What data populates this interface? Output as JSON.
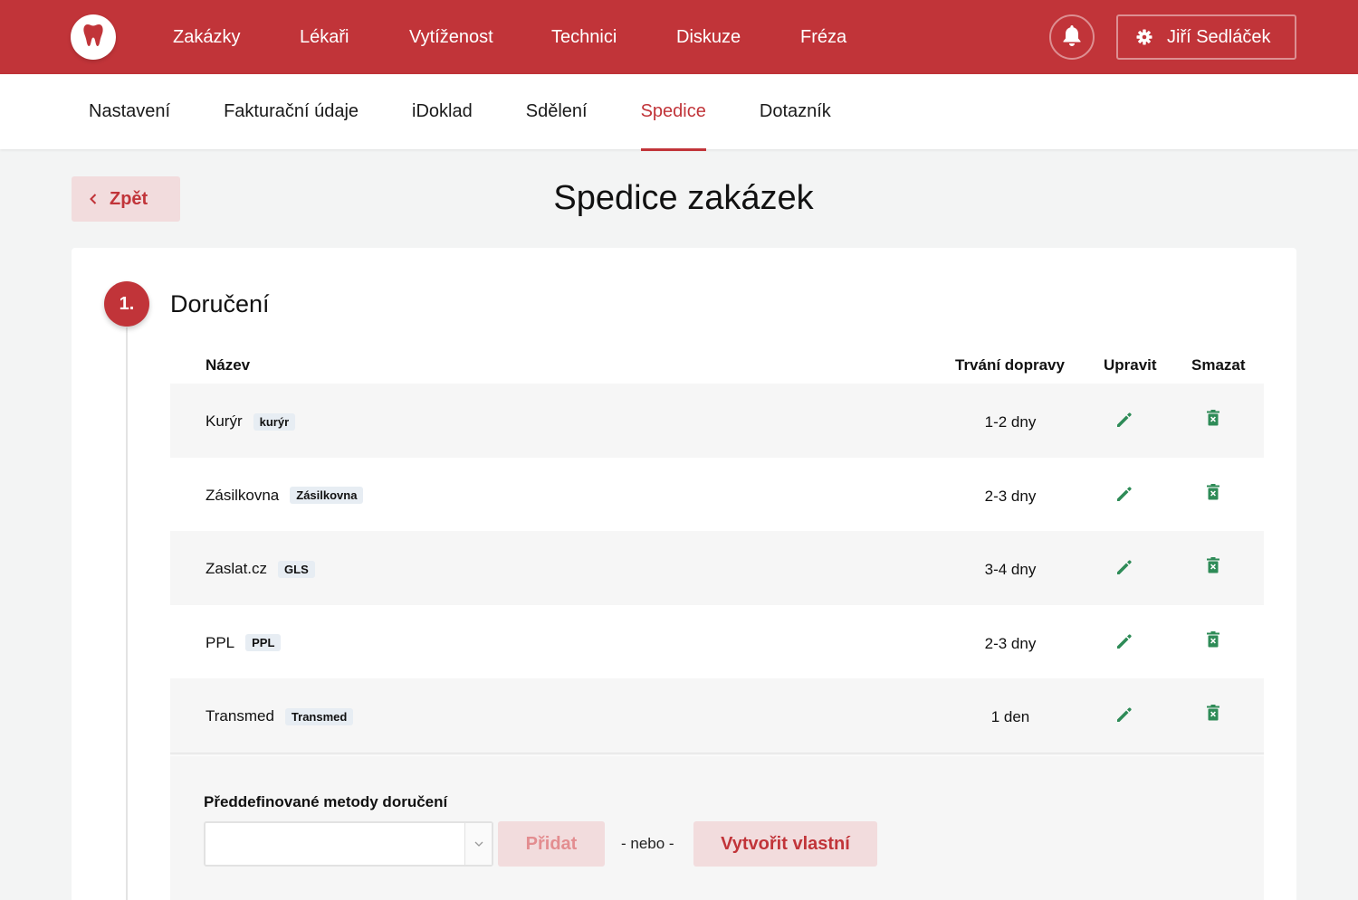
{
  "nav": {
    "items": [
      {
        "label": "Zakázky"
      },
      {
        "label": "Lékaři"
      },
      {
        "label": "Vytíženost"
      },
      {
        "label": "Technici"
      },
      {
        "label": "Diskuze"
      },
      {
        "label": "Fréza"
      }
    ],
    "user_name": "Jiří Sedláček"
  },
  "subnav": {
    "items": [
      {
        "label": "Nastavení"
      },
      {
        "label": "Fakturační údaje"
      },
      {
        "label": "iDoklad"
      },
      {
        "label": "Sdělení"
      },
      {
        "label": "Spedice",
        "active": true
      },
      {
        "label": "Dotazník"
      }
    ]
  },
  "back_label": "Zpět",
  "page_title": "Spedice zakázek",
  "section": {
    "step": "1.",
    "title": "Doručení",
    "columns": {
      "name": "Název",
      "duration": "Trvání dopravy",
      "edit": "Upravit",
      "delete": "Smazat"
    },
    "rows": [
      {
        "name": "Kurýr",
        "tag": "kurýr",
        "duration": "1-2 dny"
      },
      {
        "name": "Zásilkovna",
        "tag": "Zásilkovna",
        "duration": "2-3 dny"
      },
      {
        "name": "Zaslat.cz",
        "tag": "GLS",
        "duration": "3-4 dny"
      },
      {
        "name": "PPL",
        "tag": "PPL",
        "duration": "2-3 dny"
      },
      {
        "name": "Transmed",
        "tag": "Transmed",
        "duration": "1 den"
      }
    ],
    "add": {
      "label": "Předdefinované metody doručení",
      "select_value": "",
      "add_button": "Přidat",
      "or_text": "- nebo -",
      "create_button": "Vytvořit vlastní"
    }
  },
  "colors": {
    "brand": "#c13439",
    "action_icon": "#2e8b57",
    "light_brand": "#f2dcdd"
  },
  "icons": {
    "logo": "tooth-icon",
    "notifications": "bell-icon",
    "settings": "gear-icon",
    "back": "chevron-left-icon",
    "edit": "pencil-icon",
    "delete": "trash-icon",
    "select": "chevron-down-icon"
  }
}
